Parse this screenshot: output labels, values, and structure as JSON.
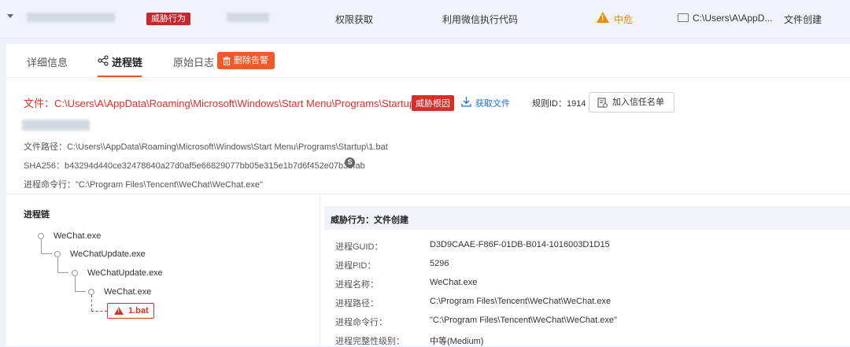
{
  "top_row": {
    "badge": "威胁行为",
    "tactic": "权限获取",
    "technique": "利用微信执行代码",
    "risk_icon": "warning-triangle-icon",
    "risk": "中危",
    "path": "C:\\Users\\A\\AppD...",
    "event_type": "文件创建",
    "colors": {
      "badge": "#c7262b",
      "risk": "#f08a00"
    }
  },
  "tabs": [
    {
      "label": "详细信息"
    },
    {
      "label": "进程链"
    },
    {
      "label": "原始日志"
    }
  ],
  "delete_button": "删除告警",
  "file": {
    "title": "文件：C:\\Users\\A\\AppData\\Roaming\\Microsoft\\Windows\\Start Menu\\Programs\\Startup\\1.bat",
    "root_badge": "威胁根因",
    "fetch_label": "获取文件",
    "rule_id": "规则ID：1914",
    "trust_button": "加入信任名单",
    "path_line": "文件路径：C:\\Users\\\\AppData\\Roaming\\Microsoft\\Windows\\Start Menu\\Programs\\Startup\\1.bat",
    "sha_line": "SHA256：b43294d440ce32478640a27d0af5e66829077bb05e315e1b7d6f452e07b3bfab",
    "sha_icon_glyph": "S",
    "cmd_line": "进程命令行：\"C:\\Program Files\\Tencent\\WeChat\\WeChat.exe\""
  },
  "process_chain": {
    "title": "进程链",
    "nodes": [
      "WeChat.exe",
      "WeChatUpdate.exe",
      "WeChatUpdate.exe",
      "WeChat.exe"
    ],
    "leaf": "1.bat"
  },
  "detail": {
    "header": "威胁行为：文件创建",
    "rows": [
      {
        "label": "进程GUID：",
        "value": "D3D9CAAE-F86F-01DB-B014-1016003D1D15"
      },
      {
        "label": "进程PID：",
        "value": "5296"
      },
      {
        "label": "进程名称：",
        "value": "WeChat.exe"
      },
      {
        "label": "进程路径：",
        "value": "C:\\Program Files\\Tencent\\WeChat\\WeChat.exe"
      },
      {
        "label": "进程命令行：",
        "value": "\"C:\\Program Files\\Tencent\\WeChat\\WeChat.exe\""
      },
      {
        "label": "进程完整性级别：",
        "value": "中等(Medium)"
      }
    ]
  }
}
